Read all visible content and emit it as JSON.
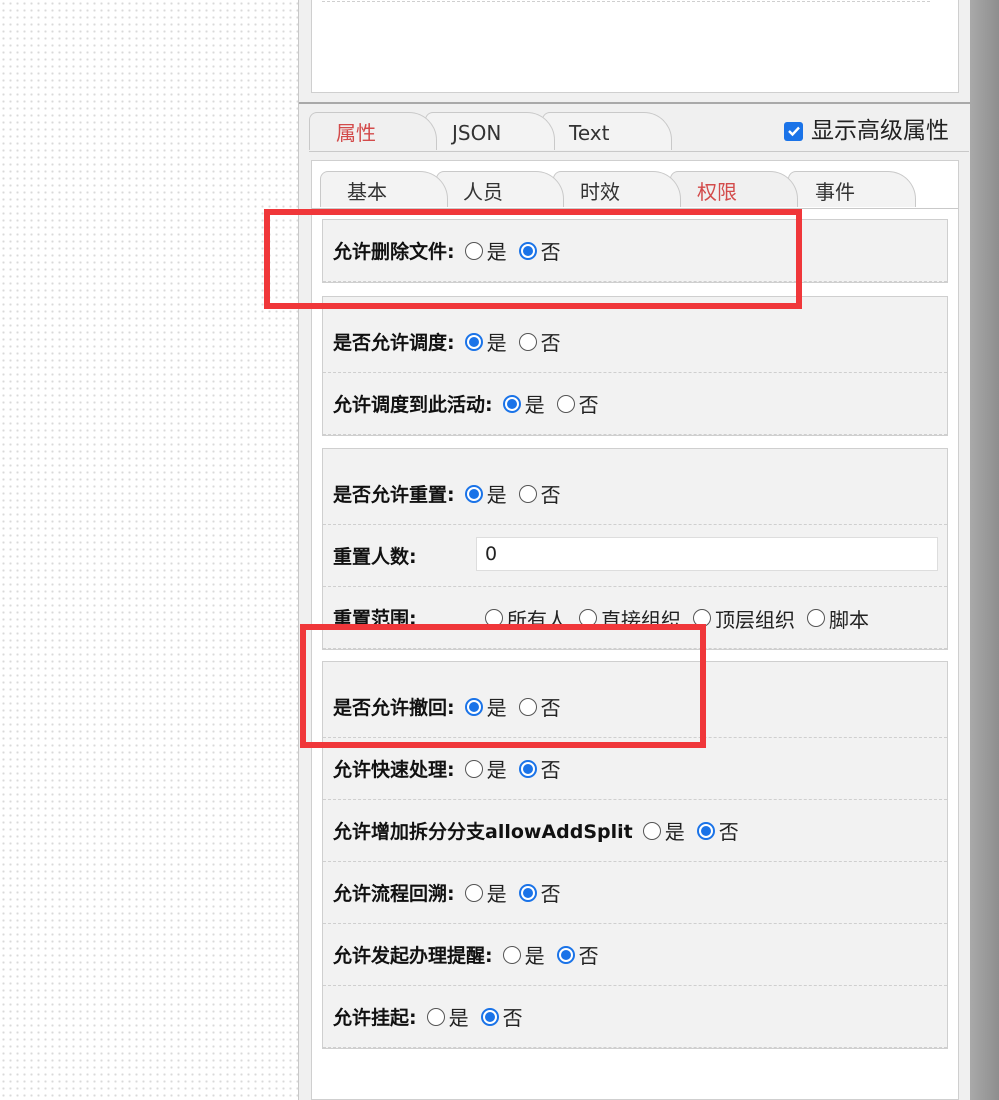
{
  "tabs_main": [
    {
      "label": "属性",
      "active": true
    },
    {
      "label": "JSON",
      "active": false
    },
    {
      "label": "Text",
      "active": false
    }
  ],
  "advanced_toggle": {
    "label": "显示高级属性",
    "checked": true
  },
  "tabs_sub": [
    {
      "label": "基本",
      "active": false
    },
    {
      "label": "人员",
      "active": false
    },
    {
      "label": "时效",
      "active": false
    },
    {
      "label": "权限",
      "active": true
    },
    {
      "label": "事件",
      "active": false
    }
  ],
  "options": {
    "yes": "是",
    "no": "否"
  },
  "rows": {
    "delete_file": {
      "label": "允许删除文件:",
      "value": "否"
    },
    "allow_dispatch": {
      "label": "是否允许调度:",
      "value": "是"
    },
    "dispatch_to_activity": {
      "label": "允许调度到此活动:",
      "value": "是"
    },
    "allow_reset": {
      "label": "是否允许重置:",
      "value": "是"
    },
    "reset_count": {
      "label": "重置人数:",
      "value": "0"
    },
    "reset_range": {
      "label": "重置范围:",
      "options": [
        "所有人",
        "直接组织",
        "顶层组织",
        "脚本"
      ]
    },
    "allow_retract": {
      "label": "是否允许撤回:",
      "value": "是"
    },
    "quick_process": {
      "label": "允许快速处理:",
      "value": "否"
    },
    "add_split": {
      "label": "允许增加拆分分支allowAddSplit",
      "value": "否"
    },
    "flow_backtrack": {
      "label": "允许流程回溯:",
      "value": "否"
    },
    "start_reminder": {
      "label": "允许发起办理提醒:",
      "value": "否"
    },
    "suspend": {
      "label": "允许挂起:",
      "value": "否"
    }
  },
  "colors": {
    "accent": "#1a73e8",
    "active_tab": "#d34b4b",
    "highlight": "#f0373a"
  }
}
